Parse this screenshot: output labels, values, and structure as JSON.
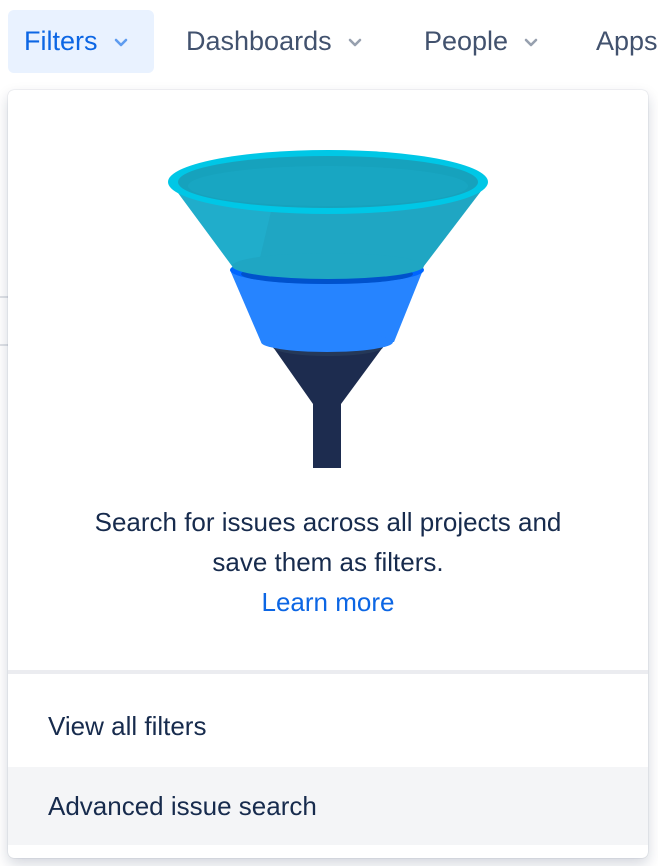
{
  "nav": {
    "items": [
      {
        "label": "Filters",
        "active": true,
        "chevron_icon": "chevron-down-icon"
      },
      {
        "label": "Dashboards",
        "active": false,
        "chevron_icon": "chevron-down-icon"
      },
      {
        "label": "People",
        "active": false,
        "chevron_icon": "chevron-down-icon"
      },
      {
        "label": "Apps",
        "active": false,
        "chevron_icon": "chevron-down-icon"
      }
    ]
  },
  "dropdown": {
    "illustration_icon": "funnel-illustration",
    "description_line1": "Search for issues across all projects and",
    "description_line2": "save them as filters.",
    "learn_more": "Learn more",
    "menu": {
      "view_all_filters": "View all filters",
      "advanced_issue_search": "Advanced issue search"
    }
  },
  "colors": {
    "active_nav_bg": "#e9f2ff",
    "active_nav_text": "#0c66e4",
    "link": "#0c66e4",
    "text": "#172b4d",
    "nav_text": "#42526e",
    "hover_bg": "#f4f5f7",
    "funnel_top": "#00b8d9",
    "funnel_middle": "#2684ff",
    "funnel_bottom": "#1d2c4f"
  }
}
